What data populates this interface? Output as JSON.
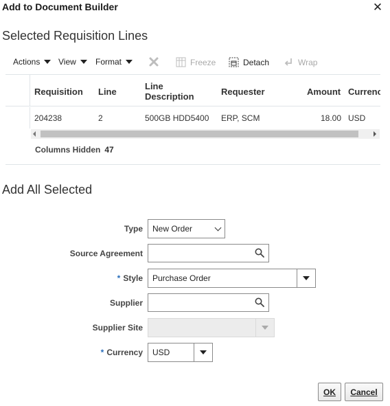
{
  "dialog": {
    "title": "Add to Document Builder",
    "close_label": "✕"
  },
  "selected_section": {
    "title": "Selected Requisition Lines"
  },
  "toolbar": {
    "actions_label": "Actions",
    "view_label": "View",
    "format_label": "Format",
    "freeze_label": "Freeze",
    "detach_label": "Detach",
    "wrap_label": "Wrap"
  },
  "table": {
    "columns": {
      "requisition": "Requisition",
      "line": "Line",
      "line_description_1": "Line",
      "line_description_2": "Description",
      "requester": "Requester",
      "amount": "Amount",
      "currency": "Currenc"
    },
    "rows": [
      {
        "requisition": "204238",
        "line": "2",
        "line_description": "500GB HDD5400",
        "requester": "ERP, SCM",
        "amount": "18.00",
        "currency": "USD"
      }
    ]
  },
  "status": {
    "columns_hidden_label": "Columns Hidden",
    "columns_hidden_count": "47"
  },
  "add_section": {
    "title": "Add All Selected"
  },
  "form": {
    "type_label": "Type",
    "type_value": "New Order",
    "source_agreement_label": "Source Agreement",
    "source_agreement_value": "",
    "style_label": "Style",
    "style_value": "Purchase Order",
    "supplier_label": "Supplier",
    "supplier_value": "",
    "supplier_site_label": "Supplier Site",
    "supplier_site_value": "",
    "currency_label": "Currency",
    "currency_value": "USD",
    "required_mark": "*"
  },
  "buttons": {
    "ok_label": "OK",
    "cancel_label": "Cancel"
  },
  "colors": {
    "required_star": "#2a6ebb",
    "border": "#8a8a8a",
    "grid_line": "#dfe4e8",
    "disabled": "#a9a9a9"
  }
}
